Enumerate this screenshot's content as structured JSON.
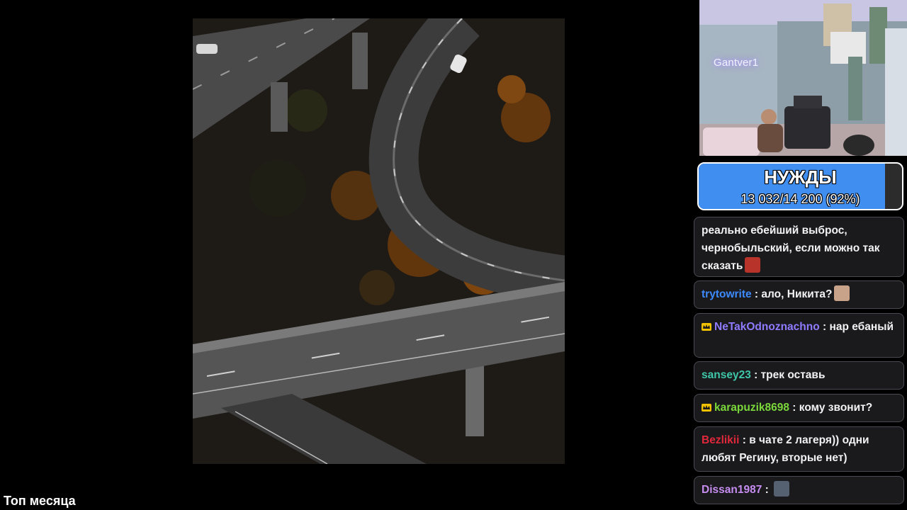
{
  "stream": {
    "webcam_name": "Gantver1",
    "footer_label": "Топ месяца"
  },
  "goal": {
    "title": "НУЖДЫ",
    "progress_text": "13 032/14 200 (92%)",
    "progress_fraction": 0.918,
    "fill_color": "#3f8ef0"
  },
  "chat": {
    "messages": [
      {
        "user": "",
        "text": "реально ебейший выброс, чернобыльский, если можно так сказать",
        "user_color": "#ffffff",
        "emote": "red-face-emote",
        "badge": ""
      },
      {
        "user": "trytowrite",
        "sep": " : ",
        "text": "ало, Никита?",
        "user_color": "#3d8bff",
        "emote": "face-emote",
        "badge": ""
      },
      {
        "user": "NeTakOdnoznachno",
        "sep": " : ",
        "text": "нар ебаный",
        "user_color": "#8f7bff",
        "emote": "",
        "badge": "crown-icon"
      },
      {
        "user": "sansey23",
        "sep": " : ",
        "text": "трек оставь",
        "user_color": "#3ec7a8",
        "emote": "",
        "badge": ""
      },
      {
        "user": "karapuzik8698",
        "sep": " : ",
        "text": "кому звонит?",
        "user_color": "#7bd83a",
        "emote": "",
        "badge": "crown-icon"
      },
      {
        "user": "Bezlikii",
        "sep": " : ",
        "text": "в чате 2 лагеря)) одни любят Регину, вторые нет)",
        "user_color": "#e0283a",
        "emote": "",
        "badge": ""
      },
      {
        "user": "Dissan1987",
        "sep": " : ",
        "text": "",
        "user_color": "#c68df0",
        "emote": "figure-emote",
        "badge": ""
      }
    ]
  }
}
